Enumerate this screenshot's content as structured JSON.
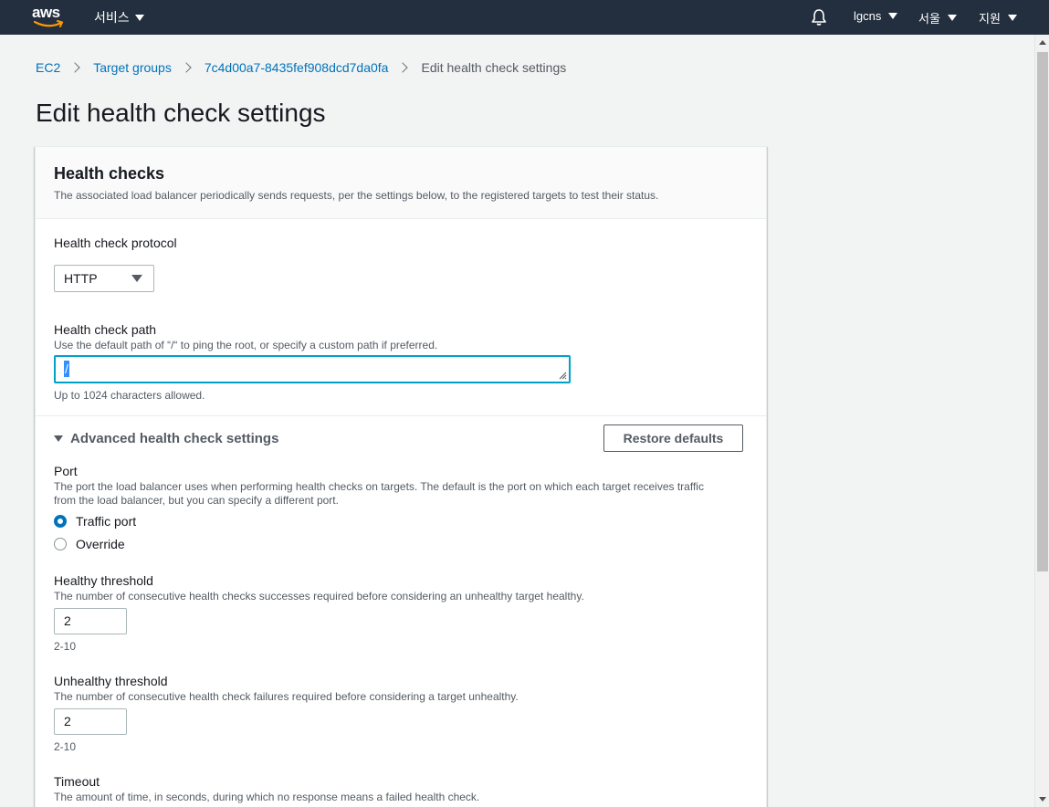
{
  "topnav": {
    "logo_text": "aws",
    "services_label": "서비스",
    "account_label": "lgcns",
    "region_label": "서울",
    "support_label": "지원",
    "bg_color": "#232f3e"
  },
  "breadcrumb": {
    "items": [
      "EC2",
      "Target groups",
      "7c4d00a7-8435fef908dcd7da0fa"
    ],
    "current": "Edit health check settings"
  },
  "page_title": "Edit health check settings",
  "panel": {
    "title": "Health checks",
    "description": "The associated load balancer periodically sends requests, per the settings below, to the registered targets to test their status.",
    "protocol": {
      "label": "Health check protocol",
      "value": "HTTP"
    },
    "path": {
      "label": "Health check path",
      "description": "Use the default path of “/“ to ping the root, or specify a custom path if preferred.",
      "value": "/",
      "hint": "Up to 1024 characters allowed."
    },
    "advanced": {
      "toggle_label": "Advanced health check settings",
      "restore_label": "Restore defaults",
      "port": {
        "label": "Port",
        "description_line1": "The port the load balancer uses when performing health checks on targets. The default is the port on which each target receives traffic",
        "description_line2": "from the load balancer, but you can specify a different port.",
        "options": [
          "Traffic port",
          "Override"
        ],
        "selected": "Traffic port"
      },
      "healthy_threshold": {
        "label": "Healthy threshold",
        "description": "The number of consecutive health checks successes required before considering an unhealthy target healthy.",
        "value": "2",
        "range": "2-10"
      },
      "unhealthy_threshold": {
        "label": "Unhealthy threshold",
        "description": "The number of consecutive health check failures required before considering a target unhealthy.",
        "value": "2",
        "range": "2-10"
      },
      "timeout": {
        "label": "Timeout",
        "description": "The amount of time, in seconds, during which no response means a failed health check."
      }
    }
  },
  "colors": {
    "link": "#0073bb",
    "focus": "#00a1c9",
    "page_bg": "#f2f3f3"
  }
}
